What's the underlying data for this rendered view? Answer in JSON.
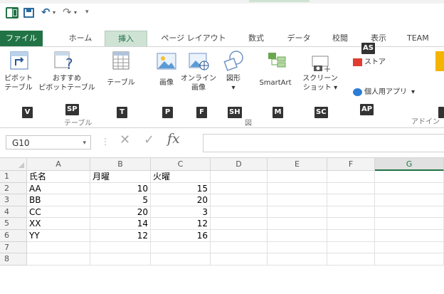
{
  "quick_access": {
    "redo_more": "▾"
  },
  "tabs": [
    {
      "label": "ファイル"
    },
    {
      "label": "ホーム"
    },
    {
      "label": "挿入"
    },
    {
      "label": "ページ レイアウト"
    },
    {
      "label": "数式"
    },
    {
      "label": "データ"
    },
    {
      "label": "校閲"
    },
    {
      "label": "表示"
    },
    {
      "label": "TEAM"
    }
  ],
  "tab_keytip": "AS",
  "ribbon": {
    "pivot": {
      "line1": "ピボット",
      "line2": "テーブル",
      "keytip": "V"
    },
    "recommended_pivot": {
      "line1": "おすすめ",
      "line2": "ピボットテーブル",
      "keytip": "SP"
    },
    "table": {
      "label": "テーブル",
      "keytip": "T"
    },
    "group_table": "テーブル",
    "picture": {
      "label": "画像",
      "keytip": "P"
    },
    "online_image": {
      "line1": "オンライン",
      "line2": "画像",
      "keytip": "F"
    },
    "shapes": {
      "line1": "図形",
      "line2": "▾",
      "keytip": "SH"
    },
    "smartart": {
      "label": "SmartArt",
      "keytip": "M"
    },
    "screenshot": {
      "line1": "スクリーン",
      "line2": "ショット ▾",
      "keytip": "SC"
    },
    "group_illust": "図",
    "store": {
      "label": "ストア"
    },
    "my_apps": {
      "label": "個人用アプリ",
      "caret": "▾",
      "keytip": "AP"
    },
    "group_apps": "アドイン"
  },
  "formula_bar": {
    "name_box": "G10",
    "name_dropdown": "▾",
    "separator": "⋮",
    "cancel": "✕",
    "enter": "✓",
    "fx": "fx",
    "value": ""
  },
  "sheet": {
    "columns": [
      "A",
      "B",
      "C",
      "D",
      "E",
      "F",
      "G"
    ],
    "selected_column": "G",
    "rows": [
      {
        "num": "1",
        "cells": [
          "氏名",
          "月曜",
          "火曜",
          "",
          "",
          "",
          ""
        ]
      },
      {
        "num": "2",
        "cells": [
          "AA",
          "10",
          "15",
          "",
          "",
          "",
          ""
        ]
      },
      {
        "num": "3",
        "cells": [
          "BB",
          "5",
          "20",
          "",
          "",
          "",
          ""
        ]
      },
      {
        "num": "4",
        "cells": [
          "CC",
          "20",
          "3",
          "",
          "",
          "",
          ""
        ]
      },
      {
        "num": "5",
        "cells": [
          "XX",
          "14",
          "12",
          "",
          "",
          "",
          ""
        ]
      },
      {
        "num": "6",
        "cells": [
          "YY",
          "12",
          "16",
          "",
          "",
          "",
          ""
        ]
      },
      {
        "num": "7",
        "cells": [
          "",
          "",
          "",
          "",
          "",
          "",
          ""
        ]
      },
      {
        "num": "8",
        "cells": [
          "",
          "",
          "",
          "",
          "",
          "",
          ""
        ]
      }
    ]
  },
  "colors": {
    "accent": "#217346",
    "active_tab_bg": "#cfe3d5",
    "keytip_bg": "#333333"
  }
}
